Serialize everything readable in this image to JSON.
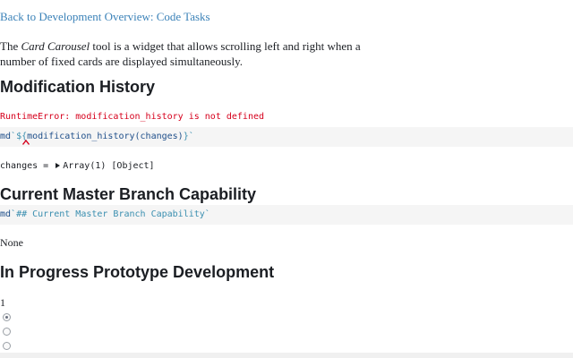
{
  "nav": {
    "back_link": "Back to Development Overview: Code Tasks"
  },
  "intro": {
    "prefix": "The ",
    "tool_name": "Card Carousel",
    "suffix": " tool is a widget that allows scrolling left and right when a number of fixed cards are displayed simultaneously."
  },
  "sections": {
    "modification_history": {
      "title": "Modification History",
      "error": "RuntimeError: modification_history is not defined",
      "code": {
        "tag": "md",
        "tick_open": "`${",
        "call": "modification_history(changes)",
        "tick_close": "}`"
      },
      "observation": {
        "label": "changes = ",
        "value": "Array(1) [Object]"
      }
    },
    "current_master": {
      "title": "Current Master Branch Capability",
      "code": {
        "tag": "md",
        "string": "`## Current Master Branch Capability`"
      },
      "output": "None"
    },
    "in_progress": {
      "title": "In Progress Prototype Development",
      "output": "1",
      "radios": [
        {
          "checked": true
        },
        {
          "checked": false
        },
        {
          "checked": false
        }
      ]
    }
  },
  "colors": {
    "link": "#3b82b8",
    "error": "#d6001c",
    "code_bg": "#f5f5f5",
    "keyword": "#1f4f8a",
    "string": "#3b8fb0"
  }
}
